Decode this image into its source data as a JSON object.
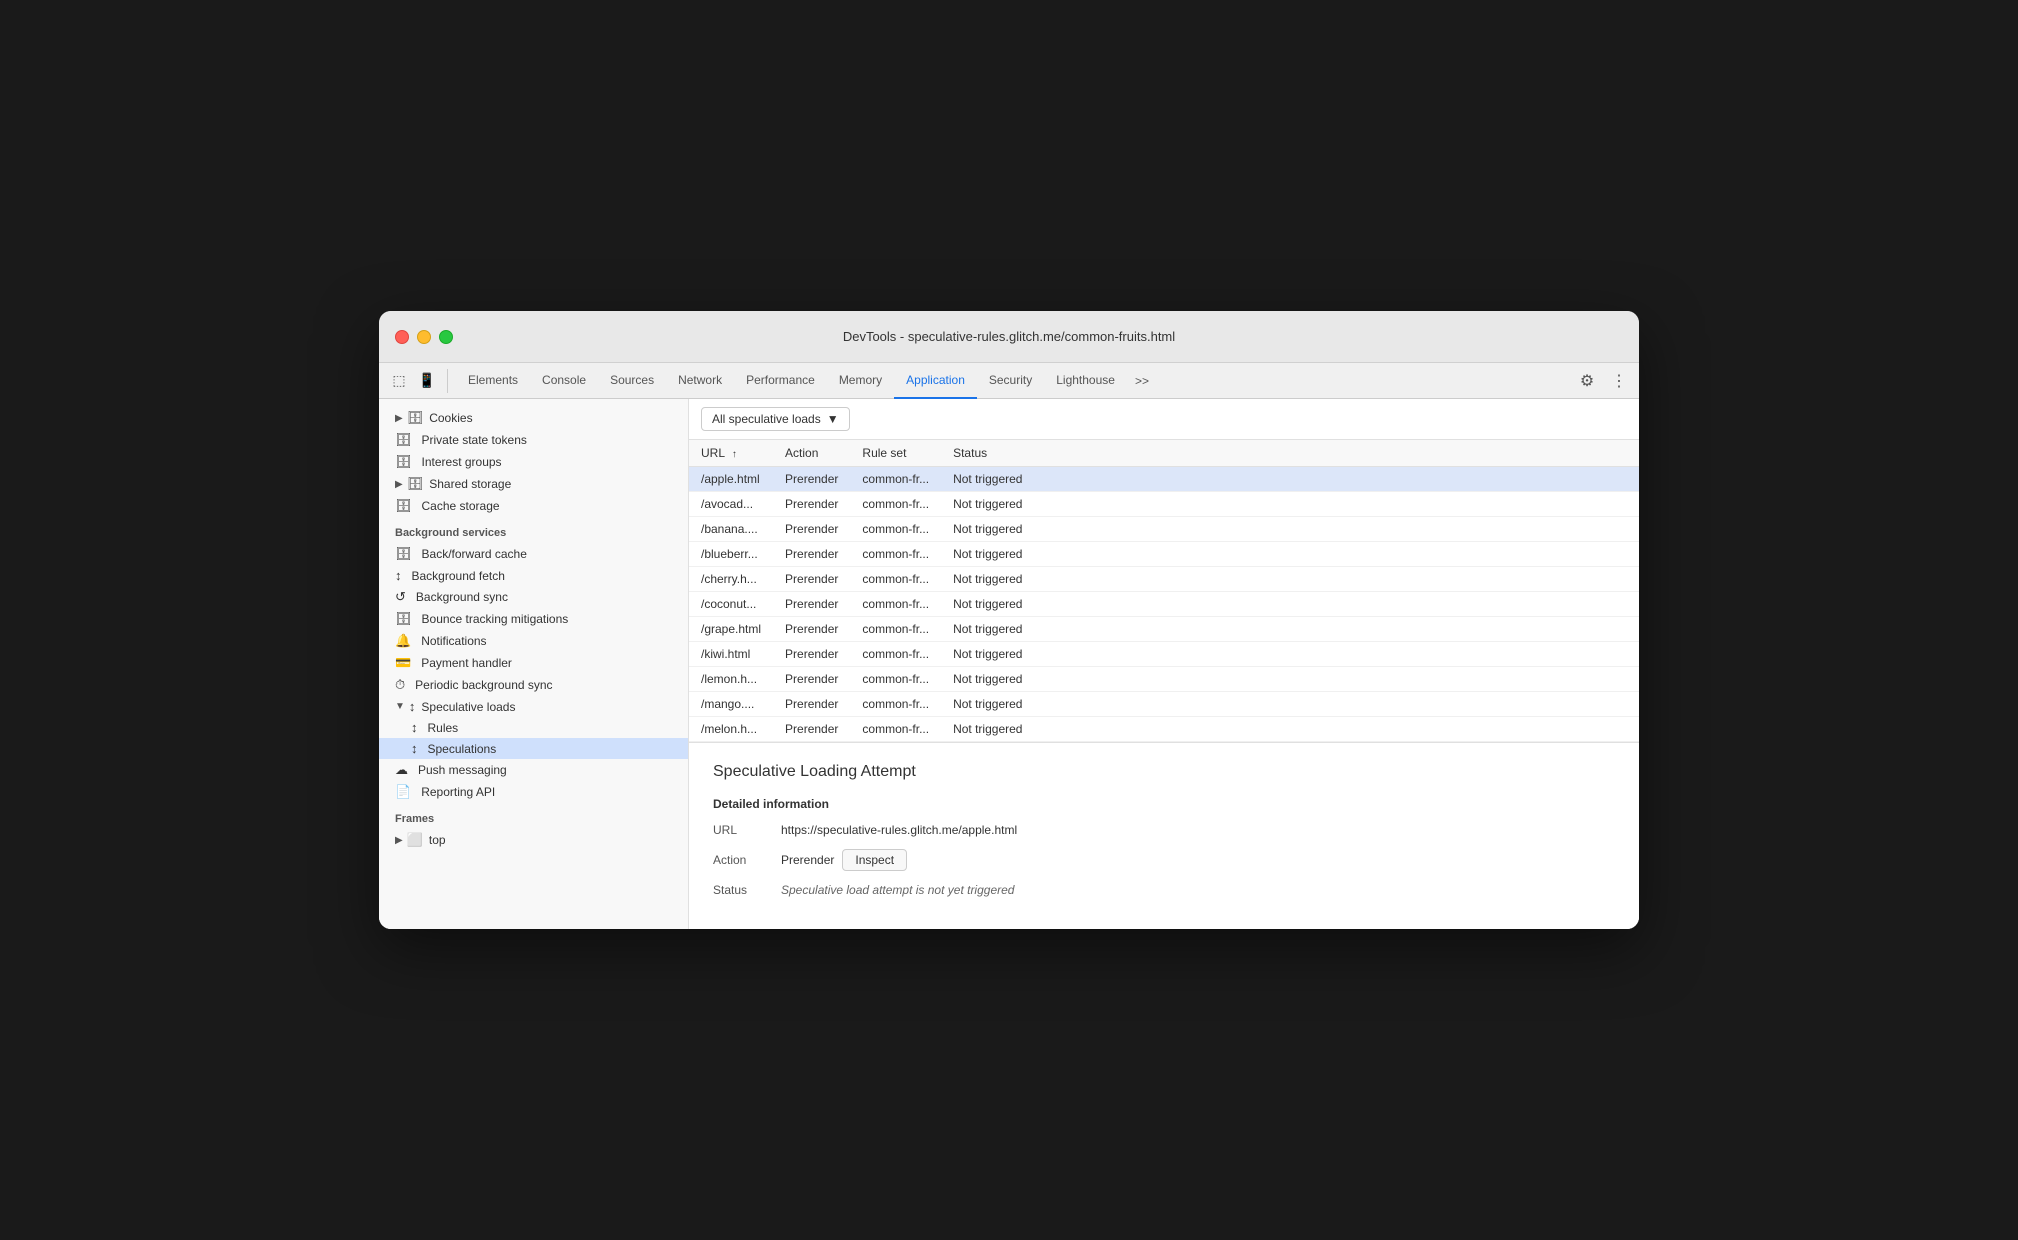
{
  "window": {
    "title": "DevTools - speculative-rules.glitch.me/common-fruits.html"
  },
  "tabs": [
    {
      "label": "Elements",
      "active": false
    },
    {
      "label": "Console",
      "active": false
    },
    {
      "label": "Sources",
      "active": false
    },
    {
      "label": "Network",
      "active": false
    },
    {
      "label": "Performance",
      "active": false
    },
    {
      "label": "Memory",
      "active": false
    },
    {
      "label": "Application",
      "active": true
    },
    {
      "label": "Security",
      "active": false
    },
    {
      "label": "Lighthouse",
      "active": false
    }
  ],
  "sidebar": {
    "storage_items": [
      {
        "label": "Cookies",
        "icon": "▶",
        "indent": 0,
        "has_arrow": true
      },
      {
        "label": "Private state tokens",
        "icon": "🗄",
        "indent": 0
      },
      {
        "label": "Interest groups",
        "icon": "🗄",
        "indent": 0
      },
      {
        "label": "Shared storage",
        "icon": "▶",
        "indent": 0,
        "has_arrow": true,
        "icon2": "🗄"
      },
      {
        "label": "Cache storage",
        "icon": "🗄",
        "indent": 0
      }
    ],
    "background_section": "Background services",
    "background_items": [
      {
        "label": "Back/forward cache",
        "icon": "🗄"
      },
      {
        "label": "Background fetch",
        "icon": "↕"
      },
      {
        "label": "Background sync",
        "icon": "↺"
      },
      {
        "label": "Bounce tracking mitigations",
        "icon": "🗄"
      },
      {
        "label": "Notifications",
        "icon": "🔔"
      },
      {
        "label": "Payment handler",
        "icon": "💳"
      },
      {
        "label": "Periodic background sync",
        "icon": "⏱"
      },
      {
        "label": "Speculative loads",
        "icon": "↕",
        "expanded": true
      },
      {
        "label": "Rules",
        "icon": "↕",
        "indent": 1
      },
      {
        "label": "Speculations",
        "icon": "↕",
        "indent": 1,
        "active": true
      },
      {
        "label": "Push messaging",
        "icon": "☁"
      },
      {
        "label": "Reporting API",
        "icon": "📄"
      }
    ],
    "frames_section": "Frames",
    "frames_items": [
      {
        "label": "top",
        "icon": "▶",
        "icon2": "⬜"
      }
    ]
  },
  "filter": {
    "label": "All speculative loads",
    "dropdown_icon": "▼"
  },
  "table": {
    "columns": [
      "URL",
      "Action",
      "Rule set",
      "Status"
    ],
    "rows": [
      {
        "url": "/apple.html",
        "action": "Prerender",
        "ruleset": "common-fr...",
        "status": "Not triggered",
        "selected": true
      },
      {
        "url": "/avocad...",
        "action": "Prerender",
        "ruleset": "common-fr...",
        "status": "Not triggered"
      },
      {
        "url": "/banana....",
        "action": "Prerender",
        "ruleset": "common-fr...",
        "status": "Not triggered"
      },
      {
        "url": "/blueberr...",
        "action": "Prerender",
        "ruleset": "common-fr...",
        "status": "Not triggered"
      },
      {
        "url": "/cherry.h...",
        "action": "Prerender",
        "ruleset": "common-fr...",
        "status": "Not triggered"
      },
      {
        "url": "/coconut...",
        "action": "Prerender",
        "ruleset": "common-fr...",
        "status": "Not triggered"
      },
      {
        "url": "/grape.html",
        "action": "Prerender",
        "ruleset": "common-fr...",
        "status": "Not triggered"
      },
      {
        "url": "/kiwi.html",
        "action": "Prerender",
        "ruleset": "common-fr...",
        "status": "Not triggered"
      },
      {
        "url": "/lemon.h...",
        "action": "Prerender",
        "ruleset": "common-fr...",
        "status": "Not triggered"
      },
      {
        "url": "/mango....",
        "action": "Prerender",
        "ruleset": "common-fr...",
        "status": "Not triggered"
      },
      {
        "url": "/melon.h...",
        "action": "Prerender",
        "ruleset": "common-fr...",
        "status": "Not triggered"
      }
    ]
  },
  "detail": {
    "title": "Speculative Loading Attempt",
    "section_title": "Detailed information",
    "url_label": "URL",
    "url_value": "https://speculative-rules.glitch.me/apple.html",
    "action_label": "Action",
    "action_value": "Prerender",
    "inspect_button": "Inspect",
    "status_label": "Status",
    "status_value": "Speculative load attempt is not yet triggered"
  }
}
